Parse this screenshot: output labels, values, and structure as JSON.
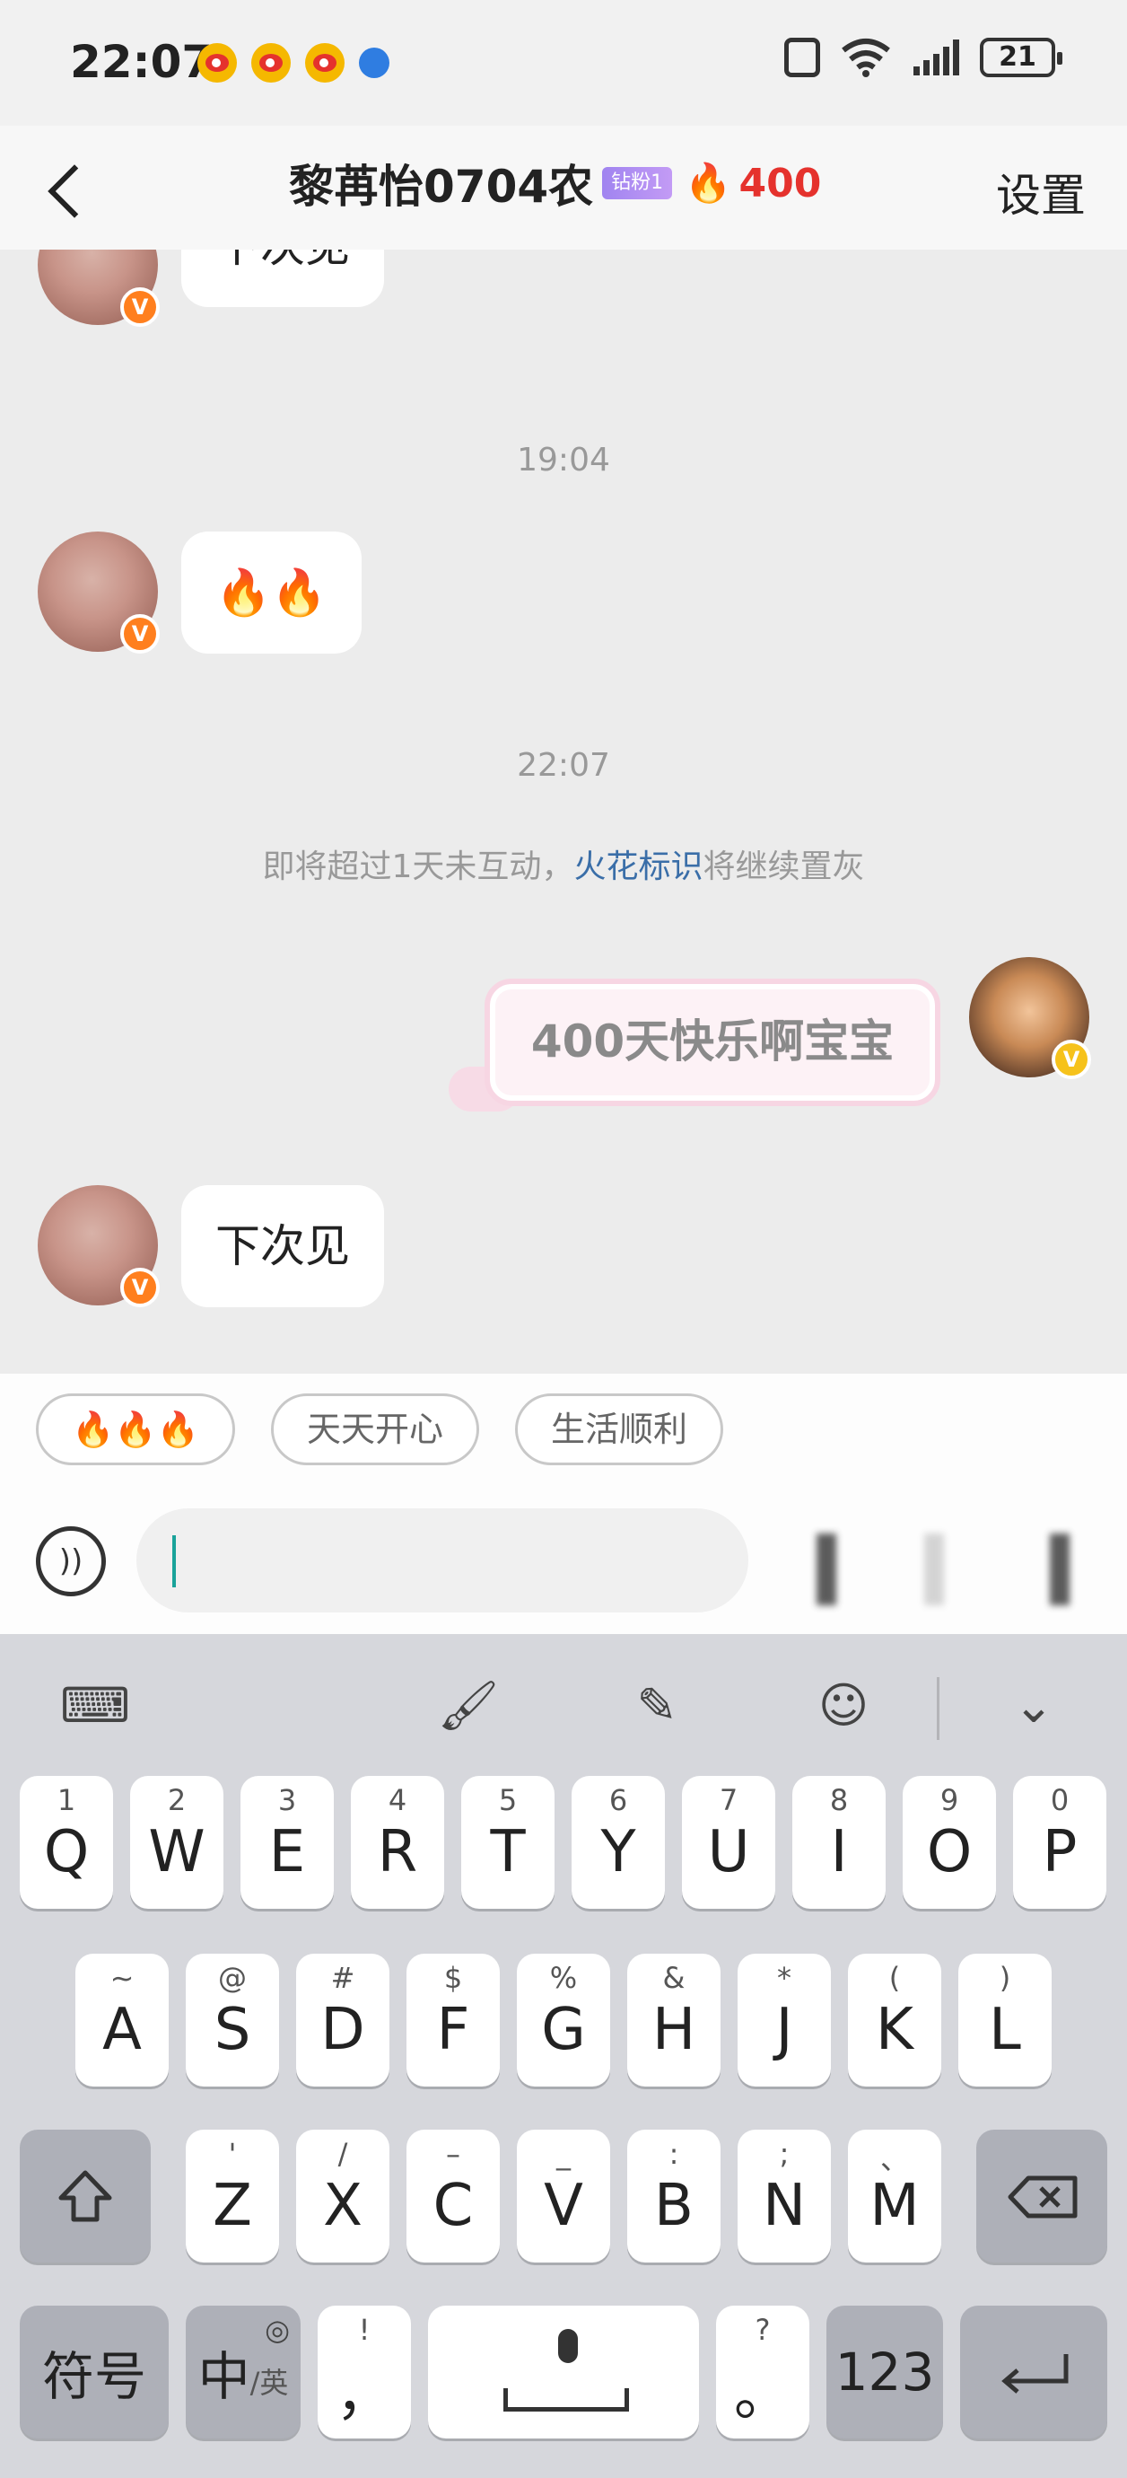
{
  "status_bar": {
    "time": "22:07",
    "battery": "21"
  },
  "header": {
    "title": "黎苒怡0704农",
    "fan_badge": "钻粉1",
    "streak_count": "400",
    "settings_label": "设置"
  },
  "chat": {
    "messages": [
      {
        "text": "下次见"
      },
      {
        "text": "🔥🔥"
      },
      {
        "text": "400天快乐啊宝宝"
      },
      {
        "text": "下次见"
      }
    ],
    "timestamps": [
      "19:04",
      "22:07"
    ],
    "notice": {
      "prefix": "即将超过1天未互动，",
      "link": "火花标识",
      "suffix": "将继续置灰"
    }
  },
  "quick_replies": [
    "🔥🔥🔥",
    "天天开心",
    "生活顺利"
  ],
  "input": {
    "value": "",
    "placeholder": ""
  },
  "keyboard": {
    "row1": [
      {
        "hint": "1",
        "key": "Q"
      },
      {
        "hint": "2",
        "key": "W"
      },
      {
        "hint": "3",
        "key": "E"
      },
      {
        "hint": "4",
        "key": "R"
      },
      {
        "hint": "5",
        "key": "T"
      },
      {
        "hint": "6",
        "key": "Y"
      },
      {
        "hint": "7",
        "key": "U"
      },
      {
        "hint": "8",
        "key": "I"
      },
      {
        "hint": "9",
        "key": "O"
      },
      {
        "hint": "0",
        "key": "P"
      }
    ],
    "row2": [
      {
        "hint": "~",
        "key": "A"
      },
      {
        "hint": "@",
        "key": "S"
      },
      {
        "hint": "#",
        "key": "D"
      },
      {
        "hint": "$",
        "key": "F"
      },
      {
        "hint": "%",
        "key": "G"
      },
      {
        "hint": "&",
        "key": "H"
      },
      {
        "hint": "*",
        "key": "J"
      },
      {
        "hint": "(",
        "key": "K"
      },
      {
        "hint": ")",
        "key": "L"
      }
    ],
    "row3": [
      {
        "hint": "'",
        "key": "Z"
      },
      {
        "hint": "/",
        "key": "X"
      },
      {
        "hint": "–",
        "key": "C"
      },
      {
        "hint": "_",
        "key": "V"
      },
      {
        "hint": ":",
        "key": "B"
      },
      {
        "hint": ";",
        "key": "N"
      },
      {
        "hint": "、",
        "key": "M"
      }
    ],
    "symbols_label": "符号",
    "lang_main": "中",
    "lang_sub": "/英",
    "comma_hint": "!",
    "comma": "，",
    "period_hint": "?",
    "period": "。",
    "numbers_label": "123"
  }
}
